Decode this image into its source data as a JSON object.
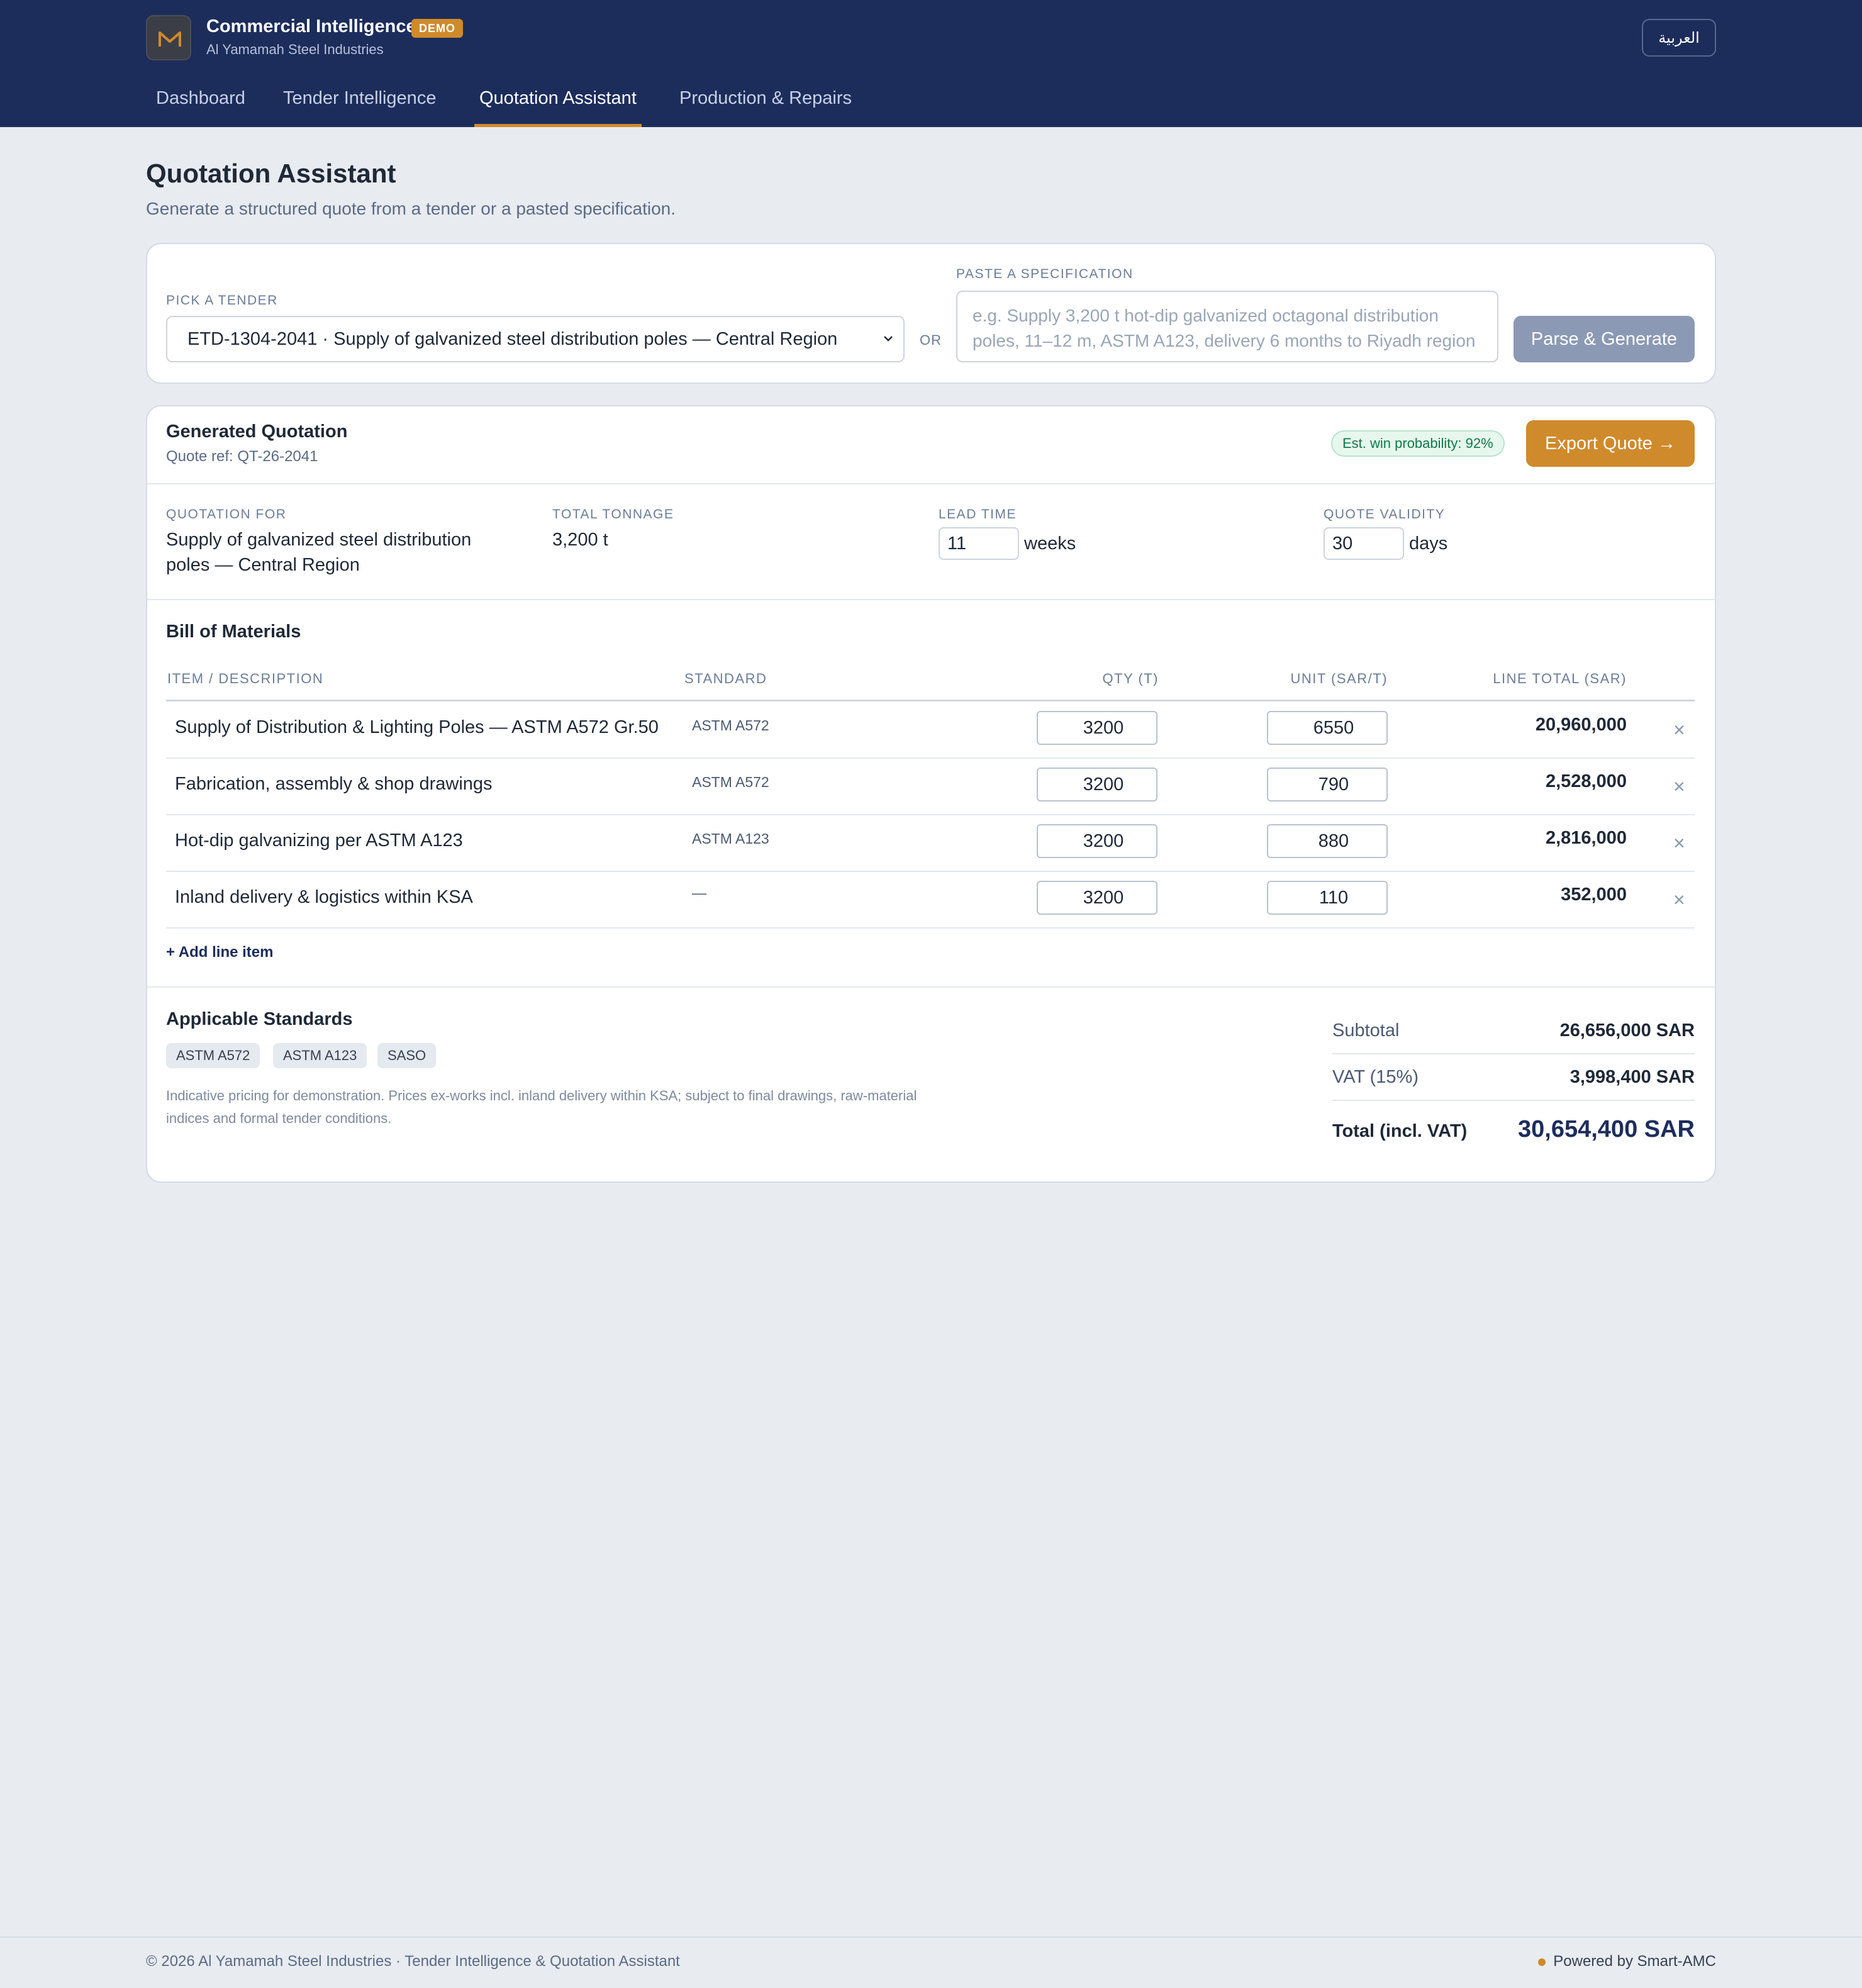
{
  "header": {
    "brand_title": "Commercial Intelligence",
    "badge": "DEMO",
    "brand_subtitle": "Al Yamamah Steel Industries",
    "language_button": "العربية",
    "logo_icon": "m-logo-icon",
    "accent_color": "#cf8a2b",
    "nav_color": "#1c2d5c"
  },
  "nav": {
    "items": [
      "Dashboard",
      "Tender Intelligence",
      "Quotation Assistant",
      "Production & Repairs"
    ],
    "active": "Quotation Assistant"
  },
  "page": {
    "title": "Quotation Assistant",
    "subtitle": "Generate a structured quote from a tender or a pasted specification."
  },
  "input": {
    "tender_label": "PICK A TENDER",
    "tender_selected": "ETD-1304-2041 · Supply of galvanized steel distribution poles — Central Region",
    "or_label": "OR",
    "spec_label": "PASTE A SPECIFICATION",
    "spec_placeholder": "e.g. Supply 3,200 t hot-dip galvanized octagonal distribution poles, 11–12 m, ASTM A123, delivery 6 months to Riyadh region",
    "parse_button": "Parse & Generate"
  },
  "quotation": {
    "title": "Generated Quotation",
    "ref": "Quote ref: QT-26-2041",
    "win_probability": "Est. win probability: 92%",
    "export_button": "Export Quote →",
    "meta": {
      "for_label": "QUOTATION FOR",
      "for_value": "Supply of galvanized steel distribution poles — Central Region",
      "tonnage_label": "TOTAL TONNAGE",
      "tonnage_value": "3,200 t",
      "lead_label": "LEAD TIME",
      "lead_value": "11",
      "lead_unit": "weeks",
      "validity_label": "QUOTE VALIDITY",
      "validity_value": "30",
      "validity_unit": "days"
    }
  },
  "bom": {
    "title": "Bill of Materials",
    "columns": [
      "ITEM / DESCRIPTION",
      "STANDARD",
      "QTY (T)",
      "UNIT (SAR/T)",
      "LINE TOTAL (SAR)"
    ],
    "rows": [
      {
        "description": "Supply of Distribution & Lighting Poles — ASTM A572 Gr.50",
        "standard": "ASTM A572",
        "qty": "3200",
        "unit": "6550",
        "total": "20,960,000"
      },
      {
        "description": "Fabrication, assembly & shop drawings",
        "standard": "ASTM A572",
        "qty": "3200",
        "unit": "790",
        "total": "2,528,000"
      },
      {
        "description": "Hot-dip galvanizing per ASTM A123",
        "standard": "ASTM A123",
        "qty": "3200",
        "unit": "880",
        "total": "2,816,000"
      },
      {
        "description": "Inland delivery & logistics within KSA",
        "standard": "—",
        "qty": "3200",
        "unit": "110",
        "total": "352,000"
      }
    ],
    "remove_glyph": "×",
    "add_line": "+ Add line item"
  },
  "standards": {
    "title": "Applicable Standards",
    "chips": [
      "ASTM A572",
      "ASTM A123",
      "SASO"
    ],
    "disclaimer": "Indicative pricing for demonstration. Prices ex-works incl. inland delivery within KSA; subject to final drawings, raw-material indices and formal tender conditions."
  },
  "summary": {
    "subtotal_label": "Subtotal",
    "subtotal_value": "26,656,000 SAR",
    "vat_label": "VAT (15%)",
    "vat_value": "3,998,400 SAR",
    "total_label": "Total (incl. VAT)",
    "total_value": "30,654,400 SAR"
  },
  "footer": {
    "left": "© 2026 Al Yamamah Steel Industries · Tender Intelligence & Quotation Assistant",
    "right": "Powered by Smart-AMC"
  }
}
